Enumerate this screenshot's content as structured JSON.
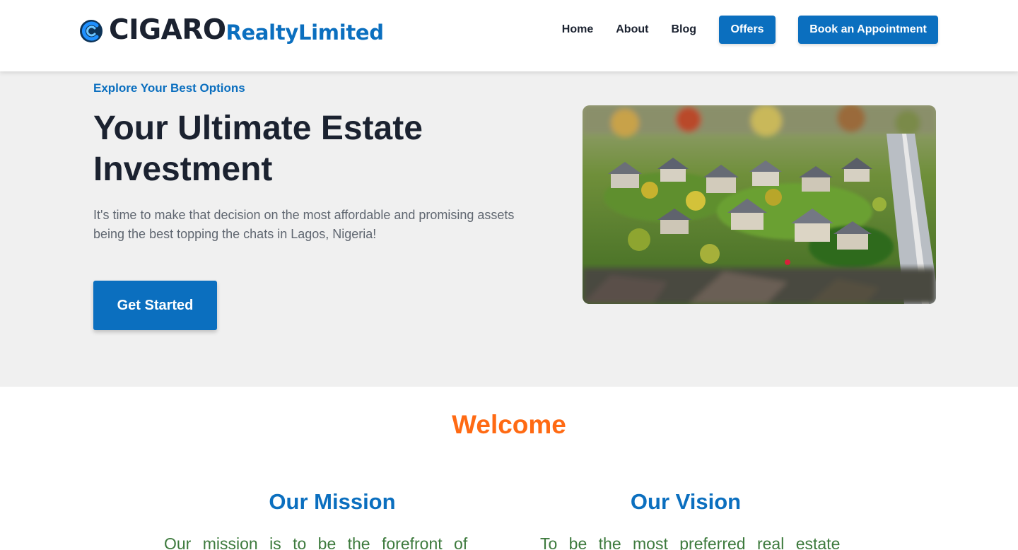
{
  "brand": {
    "name": "CIGARO",
    "tagline": "RealtyLimited"
  },
  "nav": {
    "home": "Home",
    "about": "About",
    "blog": "Blog",
    "offers": "Offers",
    "book": "Book an Appointment"
  },
  "hero": {
    "eyebrow": "Explore Your Best Options",
    "title": "Your Ultimate Estate Investment",
    "description": "It's time to make that decision on the most affordable and promising assets being the best topping the chats in Lagos, Nigeria!",
    "cta": "Get Started"
  },
  "welcome": {
    "heading": "Welcome",
    "mission_title": "Our Mission",
    "mission_text": "Our mission is to be the forefront of",
    "vision_title": "Our Vision",
    "vision_text": "To be the most preferred real estate"
  },
  "colors": {
    "primary": "#0b6fbf",
    "accent": "#ff6a13",
    "text_green": "#3d7a3d",
    "dark": "#1b2230"
  }
}
